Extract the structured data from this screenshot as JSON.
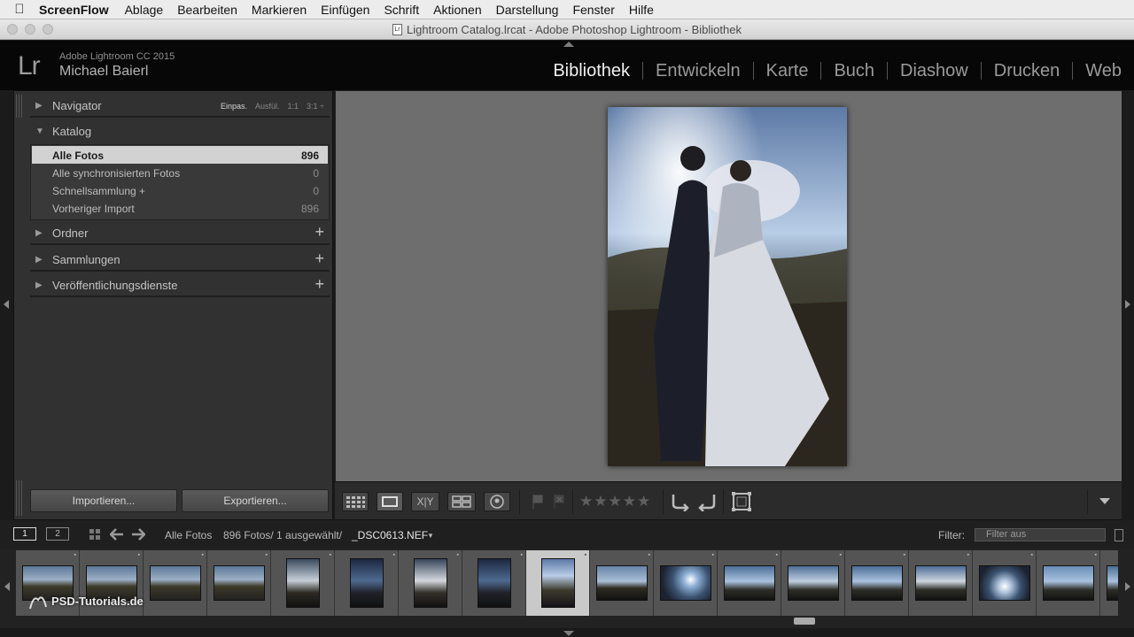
{
  "menubar": {
    "app": "ScreenFlow",
    "items": [
      "Ablage",
      "Bearbeiten",
      "Markieren",
      "Einfügen",
      "Schrift",
      "Aktionen",
      "Darstellung",
      "Fenster",
      "Hilfe"
    ]
  },
  "window": {
    "title": "Lightroom Catalog.lrcat - Adobe Photoshop Lightroom - Bibliothek",
    "doc_icon": "Lr"
  },
  "identity": {
    "logo": "Lr",
    "product": "Adobe Lightroom CC 2015",
    "user": "Michael Baierl"
  },
  "modules": [
    "Bibliothek",
    "Entwickeln",
    "Karte",
    "Buch",
    "Diashow",
    "Drucken",
    "Web"
  ],
  "left_panel": {
    "navigator": {
      "title": "Navigator",
      "options": [
        "Einpas.",
        "Ausfül.",
        "1:1",
        "3:1 ÷"
      ]
    },
    "catalog": {
      "title": "Katalog",
      "items": [
        {
          "label": "Alle Fotos",
          "count": "896"
        },
        {
          "label": "Alle synchronisierten Fotos",
          "count": "0"
        },
        {
          "label": "Schnellsammlung  +",
          "count": "0"
        },
        {
          "label": "Vorheriger Import",
          "count": "896"
        }
      ]
    },
    "folders": "Ordner",
    "collections": "Sammlungen",
    "publish": "Veröffentlichungsdienste",
    "plus": "+",
    "import_button": "Importieren...",
    "export_button": "Exportieren..."
  },
  "toolbar": {
    "stars": "★★★★★",
    "xy": "X|Y"
  },
  "filmstrip_header": {
    "screen1": "1",
    "screen2": "2",
    "source": "Alle Fotos",
    "info": "896 Fotos/ 1 ausgewählt/",
    "filename": "_DSC0613.NEF",
    "filter_label": "Filter:",
    "filter_value": "Filter aus"
  },
  "watermark": "PSD-Tutorials.de",
  "icons": [
    "apple-icon",
    "grid-view-icon",
    "loupe-view-icon",
    "compare-view-icon",
    "survey-view-icon",
    "people-view-icon",
    "flag-icon",
    "reject-flag-icon",
    "rotate-left-icon",
    "rotate-right-icon",
    "crop-icon",
    "back-arrow-icon",
    "forward-arrow-icon"
  ]
}
